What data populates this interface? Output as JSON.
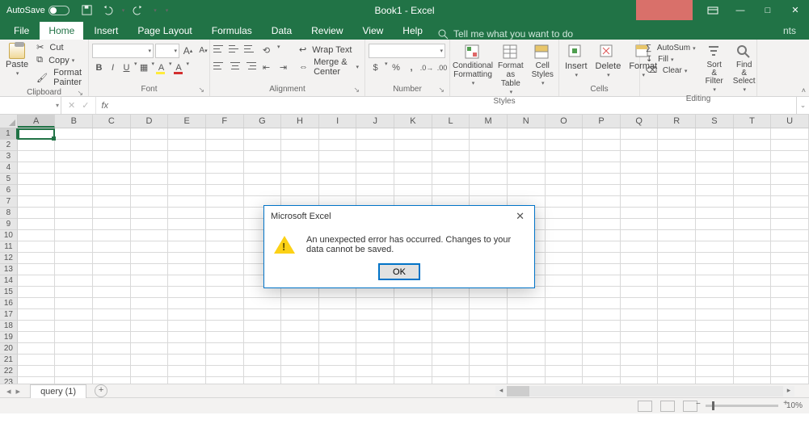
{
  "titlebar": {
    "autosave_label": "AutoSave",
    "autosave_state": "Off",
    "title": "Book1 - Excel"
  },
  "window_controls": {
    "min": "—",
    "max": "□",
    "close": "✕"
  },
  "tabs": {
    "file": "File",
    "home": "Home",
    "insert": "Insert",
    "page_layout": "Page Layout",
    "formulas": "Formulas",
    "data": "Data",
    "review": "Review",
    "view": "View",
    "help": "Help",
    "tell_me": "Tell me what you want to do",
    "right_partial": "nts"
  },
  "ribbon": {
    "clipboard": {
      "paste": "Paste",
      "cut": "Cut",
      "copy": "Copy",
      "format_painter": "Format Painter",
      "label": "Clipboard"
    },
    "font": {
      "label": "Font",
      "inc": "A▴",
      "dec": "A▾",
      "bold": "B",
      "italic": "I",
      "under": "U"
    },
    "alignment": {
      "label": "Alignment",
      "wrap": "Wrap Text",
      "merge": "Merge & Center"
    },
    "number": {
      "label": "Number",
      "currency": "$",
      "percent": "%",
      "comma": ",",
      "inc_dec": "←0",
      "dec_dec": "→0"
    },
    "styles": {
      "label": "Styles",
      "cond": "Conditional Formatting",
      "table": "Format as Table",
      "cell": "Cell Styles"
    },
    "cells": {
      "label": "Cells",
      "insert": "Insert",
      "delete": "Delete",
      "format": "Format"
    },
    "editing": {
      "label": "Editing",
      "autosum": "AutoSum",
      "fill": "Fill",
      "clear": "Clear",
      "sort": "Sort & Filter",
      "find": "Find & Select"
    }
  },
  "formula_bar": {
    "name": "",
    "fx": "fx",
    "value": ""
  },
  "grid": {
    "columns": [
      "A",
      "B",
      "C",
      "D",
      "E",
      "F",
      "G",
      "H",
      "I",
      "J",
      "K",
      "L",
      "M",
      "N",
      "O",
      "P",
      "Q",
      "R",
      "S",
      "T",
      "U"
    ],
    "rows": 23,
    "active": "A1"
  },
  "sheet_tabs": {
    "name": "query (1)",
    "add": "+"
  },
  "status": {
    "zoom": "10%"
  },
  "dialog": {
    "title": "Microsoft Excel",
    "message": "An unexpected error has occurred. Changes to your data cannot be saved.",
    "ok": "OK"
  }
}
